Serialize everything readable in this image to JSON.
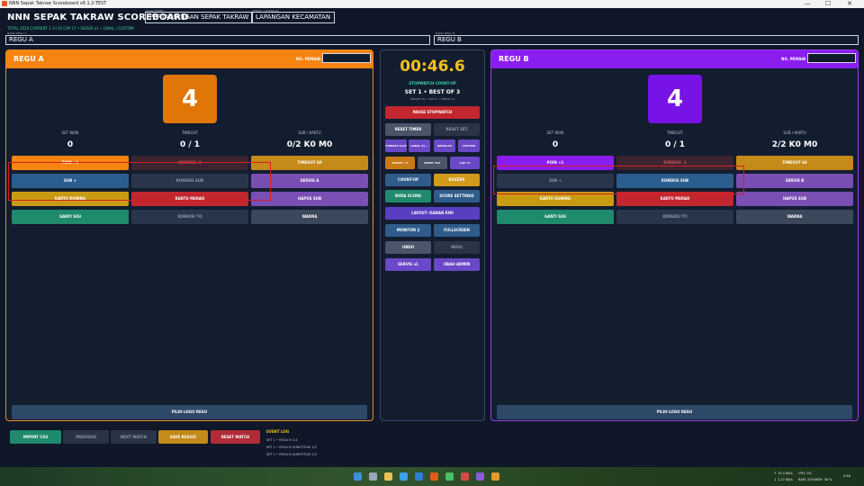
{
  "window": {
    "title": "NNN Sepak Takraw Scoreboard v6.1.2-TEST",
    "controls": [
      "—",
      "☐",
      "✕"
    ]
  },
  "header": {
    "app_title": "NNN SEPAK TAKRAW SCOREBOARD",
    "event_caption": "NAMA EVENT",
    "event_name": "PERTANDINGAN SEPAK TAKRAW",
    "venue_caption": "VENUE / LAPANGAN",
    "venue_name": "LAPANGAN KECAMATAN",
    "subline": "TOTAL 2026 CORRENT 1 3+15 CAP 17 • SERVIS x1 • LOKAL / CUSTOM",
    "team_a_caption": "NAMA REGU A",
    "team_b_caption": "NAMA REGU B",
    "team_a_name": "REGU A",
    "team_b_name": "REGU B"
  },
  "team_a": {
    "name": "REGU A",
    "player_caption": "NO. PEMAIN",
    "score": "4",
    "stats": [
      {
        "caption": "SET WON",
        "value": "0"
      },
      {
        "caption": "TIMEOUT",
        "value": "0 / 1"
      },
      {
        "caption": "SUB / KARTU",
        "value": "0/2  K0  M0"
      }
    ],
    "buttons": {
      "poin_plus": "POIN +1",
      "koreksi": "KOREKSI -1",
      "timeout": "TIMEOUT 60",
      "sub": "SUB +",
      "koreksi_sub": "KOREKSI SUB",
      "servis": "SERVIS A",
      "kartu_kuning": "KARTU KUNING",
      "kartu_merah": "KARTU MERAH",
      "hapus_sub": "HAPUS SUB",
      "ganti_sisi": "GANTI SISI",
      "koreksi_to": "KOREKSI TO",
      "warna": "WARNA"
    },
    "logo_button": "PILIH LOGO REGU"
  },
  "team_b": {
    "name": "REGU B",
    "player_caption": "NO. PEMAIN",
    "score": "4",
    "stats": [
      {
        "caption": "SET WON",
        "value": "0"
      },
      {
        "caption": "TIMEOUT",
        "value": "0 / 1"
      },
      {
        "caption": "SUB / KARTU",
        "value": "2/2  K0  M0"
      }
    ],
    "buttons": {
      "poin_plus": "POIN +1",
      "koreksi": "KOREKSI -1",
      "timeout": "TIMEOUT 60",
      "sub": "SUB +",
      "koreksi_sub": "KOREKSI SUB",
      "servis": "SERVIS B",
      "kartu_kuning": "KARTU KUNING",
      "kartu_merah": "KARTU MERAH",
      "hapus_sub": "HAPUS SUB",
      "ganti_sisi": "GANTI SISI",
      "koreksi_to": "KOREKSI TO",
      "warna": "WARNA"
    },
    "logo_button": "PILIH LOGO REGU"
  },
  "center": {
    "timer": "00:46.6",
    "timer_mode": "STOPWATCH COUNT-UP",
    "set_info": "SET 1 • BEST OF 3",
    "set_sub": "TARGET 15 • CAP 17 • SERVIS x1",
    "pause": "PAUSE STOPWATCH",
    "reset_timer": "RESET TIMER",
    "reset_set": "RESET SET",
    "format_a": "FORMAT 3x15",
    "format_b": "LOKAL 3x...",
    "regular": "REGULAR",
    "custom": "CUSTOM",
    "target": "TARGET +5",
    "reset_target": "RESET TGT",
    "cap": "CAP 17",
    "count_up": "COUNT-UP",
    "buzzer": "BUZZER",
    "buka_score": "BUKA SCORE",
    "score_settings": "SCORE SETTINGS",
    "layout": "LAYOUT: KANAN KIRI",
    "monitor": "MONITOR 2",
    "fullscreen": "FULLSCREEN",
    "undo": "UNDO",
    "redo": "REDO",
    "servis": "SERVIS x1",
    "ubah_admin": "UBAH ADMIN"
  },
  "bottom": {
    "import": "IMPORT CSV",
    "previous": "PREVIOUS",
    "next": "NEXT MATCH",
    "save": "SAVE RESULT",
    "reset": "RESET MATCH",
    "event_log_title": "EVENT LOG",
    "event_log": [
      "SET 1 • REGU B 4-4",
      "SET 1 • REGU B SUBSTITUSI 1/2",
      "SET 1 • REGU B SUBSTITUSI 2/2"
    ]
  },
  "taskbar": {
    "net_up": "↑ 15.4 KB/s",
    "net_down": "↓ 1.27 KB/s",
    "cpu": "CPU: 5%",
    "ram": "RAM: 20%",
    "mem": "MEM: 38 %",
    "clock": "9:48"
  },
  "colors": {
    "team_a": "#f58410",
    "team_b": "#8a1df0",
    "timer": "#f2c21a",
    "accent_green": "#3dd5a0",
    "background": "#0f1729"
  }
}
